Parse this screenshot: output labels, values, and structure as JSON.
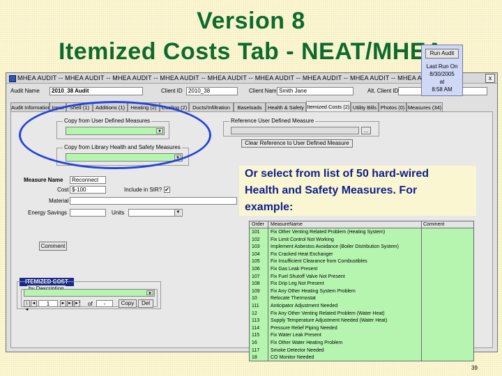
{
  "slide": {
    "title_line1": "Version 8",
    "title_line2": "Itemized Costs Tab - NEAT/MHEA",
    "page_number": "39"
  },
  "window": {
    "title": "MHEA AUDIT -- MHEA AUDIT -- MHEA AUDIT -- MHEA AUDIT -- MHEA AUDIT -- MHEA AUDIT -- MHEA AUDIT -- MHEA AUDIT -- MHEA AUDIT",
    "close_glyph": "x"
  },
  "header": {
    "audit_name_label": "Audit Name",
    "audit_name_value": "2010_38 Audit",
    "client_id_label": "Client ID",
    "client_id_value": "2010_38",
    "client_name_label": "Client Name",
    "client_name_value": "Smith Jane",
    "alt_client_id_label": "Alt. Client ID",
    "alt_client_id_value": ""
  },
  "tabs": [
    "Audit Information",
    "Input",
    "Shell (1)",
    "Additions (1)",
    "Heating (2)",
    "Cooling (2)",
    "Ducts/Infiltration",
    "Baseloads",
    "Health & Safety",
    "Itemized Costs (2)",
    "Utility Bills",
    "Photos (0)",
    "Measures (34)"
  ],
  "left": {
    "copy_user_label": "Copy from User Defined Measures",
    "copy_hs_label": "Copy from Library Health and Safety Measures",
    "measure_name_label": "Measure Name",
    "measure_name_value": "Reconnect",
    "cost_label": "Cost",
    "cost_value": "$-100",
    "include_sir_label": "Include in SIR?",
    "include_sir_checked": "✔",
    "material_label": "Material",
    "energy_savings_label": "Energy Savings",
    "units_label": "Units",
    "comment_button": "Comment"
  },
  "right": {
    "reference_user_label": "Reference User Defined Measure",
    "ellipsis_button": "...",
    "clear_reference_button": "Clear Reference to User Defined Measure"
  },
  "lastrun": {
    "run_audit_button": "Run Audit",
    "last_run_label": "Last Run On",
    "date": "8/30/2005",
    "at": "at",
    "time": "8:58 AM"
  },
  "callout": {
    "line1": "Or select from list of 50 hard-wired",
    "line2": "Health and Safety Measures. For",
    "line3": "example:"
  },
  "table": {
    "columns": [
      "Order",
      "MeasureName",
      "Comment"
    ],
    "rows": [
      [
        "101",
        "Fix Other Venting Related Problem (Heating System)",
        ""
      ],
      [
        "102",
        "Fix Limit Control Not Working",
        ""
      ],
      [
        "103",
        "Implement Asbestos Avoidance (Boiler Distribution System)",
        ""
      ],
      [
        "104",
        "Fix Cracked Heat Exchanger",
        ""
      ],
      [
        "105",
        "Fix Insufficient Clearance from Combustibles",
        ""
      ],
      [
        "106",
        "Fix Gas Leak Present",
        ""
      ],
      [
        "107",
        "Fix Fuel Shutoff Valve Not Present",
        ""
      ],
      [
        "108",
        "Fix Drip Leg Not Present",
        ""
      ],
      [
        "109",
        "Fix Any Other Heating System Problem",
        ""
      ],
      [
        "10",
        "Relocate Thermostat",
        ""
      ],
      [
        "111",
        "Anticipator Adjustment Needed",
        ""
      ],
      [
        "12",
        "Fix Any Other Venting Related Problem (Water Heat)",
        ""
      ],
      [
        "113",
        "Supply Temperature Adjustment Needed (Water Heat)",
        ""
      ],
      [
        "114",
        "Pressure Relief Piping Needed",
        ""
      ],
      [
        "115",
        "Fix Water Leak Present",
        ""
      ],
      [
        "16",
        "Fix Other Water Heating Problem",
        ""
      ],
      [
        "117",
        "Smoke Detector Needed",
        ""
      ],
      [
        "18",
        "CO Monitor Needed",
        ""
      ]
    ]
  },
  "itemized": {
    "header": "ITEMIZED COST",
    "by_description_label": "by Description",
    "record_value": "1",
    "of_label": "of",
    "of_value": "-",
    "copy_button": "Copy",
    "delete_button": "Del",
    "nav_first": "|◄",
    "nav_prev": "◄",
    "nav_next": "►",
    "nav_last": "►|",
    "nav_new": "►*"
  },
  "colors": {
    "title": "#0c6b2c",
    "callout": "#0d1f8c",
    "oval": "#2244dd",
    "grid_green": "#b6f5b0",
    "itemized_header": "#1a2a8c"
  }
}
